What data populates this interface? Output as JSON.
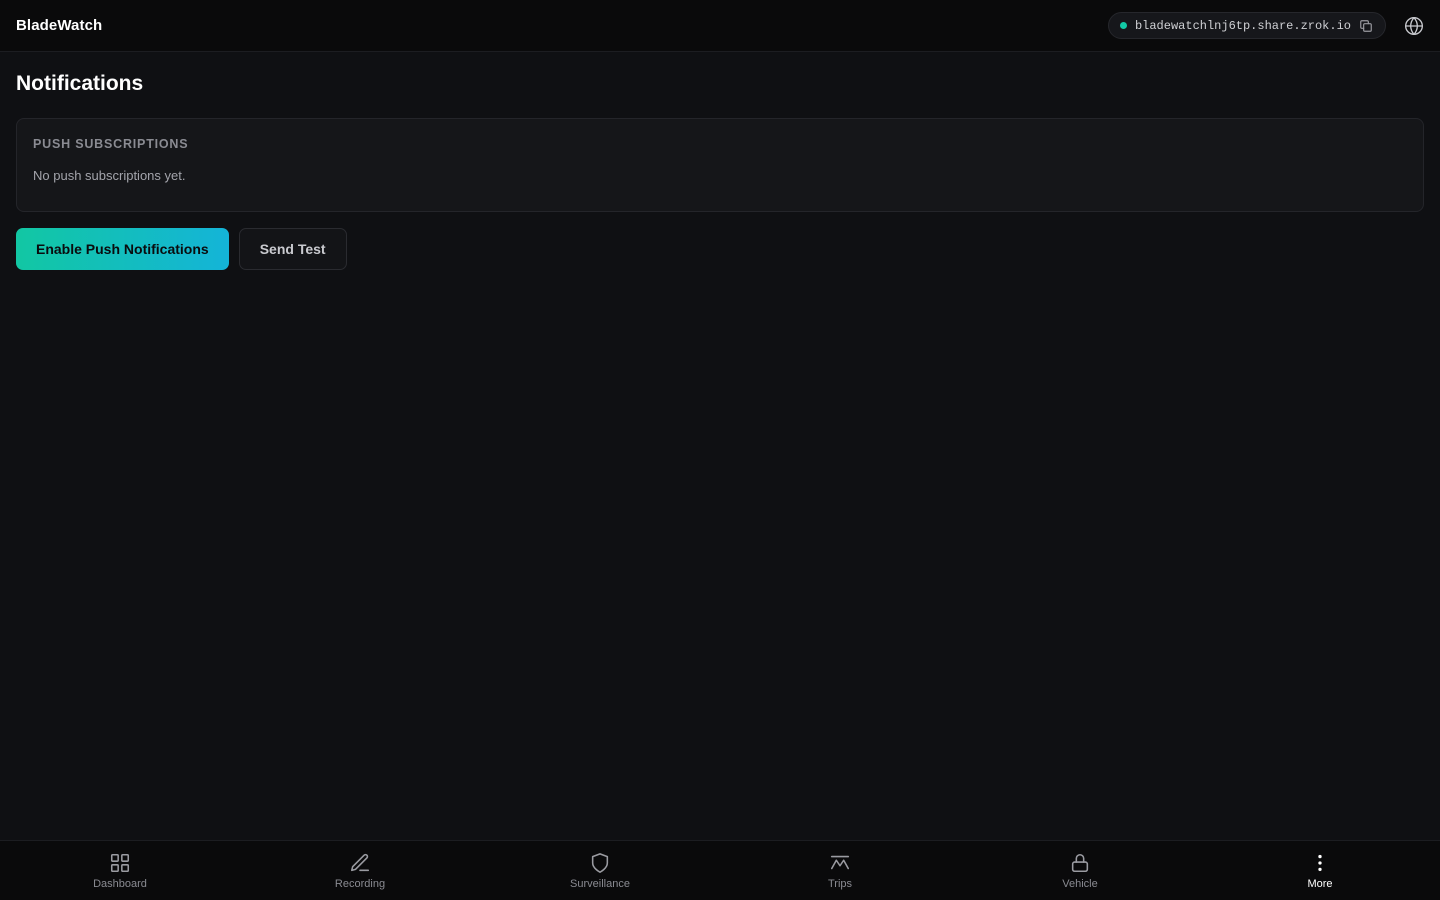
{
  "header": {
    "brand": "BladeWatch",
    "share_url": "bladewatchlnj6tp.share.zrok.io",
    "status_color": "#12c9a5",
    "copy_icon": "copy-icon",
    "globe_icon": "globe-icon"
  },
  "page": {
    "title": "Notifications"
  },
  "subscriptions": {
    "heading": "PUSH SUBSCRIPTIONS",
    "empty_text": "No push subscriptions yet."
  },
  "actions": {
    "enable_label": "Enable Push Notifications",
    "send_test_label": "Send Test"
  },
  "nav": {
    "items": [
      {
        "label": "Dashboard",
        "icon": "grid-icon",
        "active": false
      },
      {
        "label": "Recording",
        "icon": "pencil-icon",
        "active": false
      },
      {
        "label": "Surveillance",
        "icon": "shield-icon",
        "active": false
      },
      {
        "label": "Trips",
        "icon": "route-icon",
        "active": false
      },
      {
        "label": "Vehicle",
        "icon": "lock-icon",
        "active": false
      },
      {
        "label": "More",
        "icon": "more-vertical-icon",
        "active": true
      }
    ]
  },
  "colors": {
    "accent_start": "#12c7a3",
    "accent_end": "#14b4d8",
    "background": "#0f1013"
  }
}
